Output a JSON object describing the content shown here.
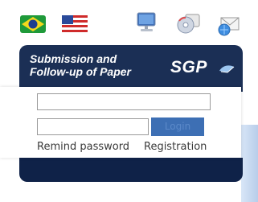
{
  "languages": [
    {
      "name": "portuguese-brazil-flag"
    },
    {
      "name": "english-us-flag"
    }
  ],
  "toolbar_icons": [
    "monitor-icon",
    "cd-icon",
    "mail-icon"
  ],
  "banner": {
    "title_line1": "Submission and",
    "title_line2": "Follow-up of Paper",
    "logo_text": "SGP"
  },
  "login": {
    "username_value": "",
    "password_value": "",
    "login_button_label": "Login",
    "remind_password_label": "Remind password",
    "registration_label": "Registration"
  },
  "colors": {
    "banner_bg": "#1b2f55",
    "button_bg": "#3d6fb4",
    "panel_shadow": "#b8cdea"
  }
}
